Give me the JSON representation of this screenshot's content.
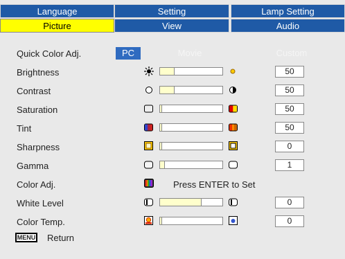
{
  "tabs_top": [
    "Language",
    "Setting",
    "Lamp Setting"
  ],
  "tabs_bottom": [
    "Picture",
    "View",
    "Audio"
  ],
  "quick_color": {
    "label": "Quick Color Adj.",
    "modes": [
      "PC",
      "Movie",
      "Custom"
    ],
    "selected": "PC"
  },
  "rows": [
    {
      "label": "Brightness",
      "value": "50",
      "level": 0.22
    },
    {
      "label": "Contrast",
      "value": "50",
      "level": 0.22
    },
    {
      "label": "Saturation",
      "value": "50",
      "level": 0.0
    },
    {
      "label": "Tint",
      "value": "50",
      "level": 0.0
    },
    {
      "label": "Sharpness",
      "value": "0",
      "level": 0.0
    },
    {
      "label": "Gamma",
      "value": "1",
      "level": 0.07
    }
  ],
  "color_adj": {
    "label": "Color Adj.",
    "hint": "Press ENTER to Set"
  },
  "white_level": {
    "label": "White Level",
    "value": "0",
    "level": 0.65
  },
  "color_temp": {
    "label": "Color Temp.",
    "value": "0",
    "level": 0.0
  },
  "footer": {
    "menu_key": "MENU",
    "return_label": "Return"
  },
  "colors": {
    "tab_blue": "#1f5aa6",
    "active_tab": "#ffff00",
    "mode_selected": "#2f6bc0",
    "background": "#e9e9e9"
  }
}
